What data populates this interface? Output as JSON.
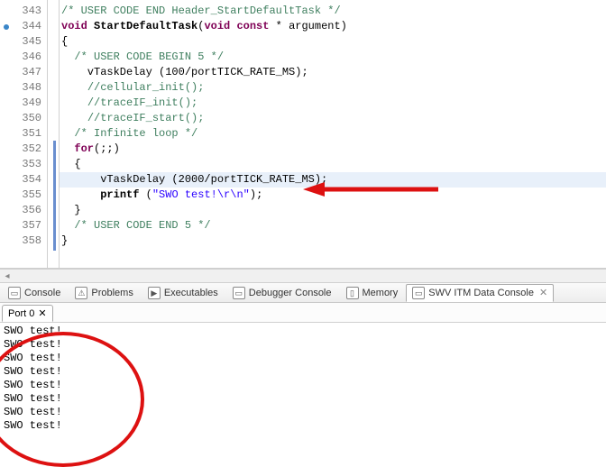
{
  "lines": [
    {
      "n": 343,
      "html": "<span class='cm'>/* USER CODE END Header_StartDefaultTask */</span>"
    },
    {
      "n": 344,
      "marked": true,
      "html": "<span class='kw'>void</span> <span class='fn'>StartDefaultTask</span>(<span class='kw'>void</span> <span class='kw'>const</span> * argument)"
    },
    {
      "n": 345,
      "html": "{"
    },
    {
      "n": 346,
      "html": "  <span class='cm'>/* USER CODE BEGIN 5 */</span>"
    },
    {
      "n": 347,
      "html": "    vTaskDelay (100/portTICK_RATE_MS);"
    },
    {
      "n": 348,
      "html": "    <span class='cm'>//cellular_init();</span>"
    },
    {
      "n": 349,
      "html": "    <span class='cm'>//traceIF_init();</span>"
    },
    {
      "n": 350,
      "html": "    <span class='cm'>//traceIF_start();</span>"
    },
    {
      "n": 351,
      "html": "  <span class='cm'>/* Infinite loop */</span>"
    },
    {
      "n": 352,
      "html": "  <span class='kw'>for</span>(;;)"
    },
    {
      "n": 353,
      "html": "  {"
    },
    {
      "n": 354,
      "hl": true,
      "html": "      vTaskDelay (2000/portTICK_RATE_MS);"
    },
    {
      "n": 355,
      "html": "      <span class='fn'>printf</span> (<span class='str'>\"SWO test!\\r\\n\"</span>);"
    },
    {
      "n": 356,
      "html": "  }"
    },
    {
      "n": 357,
      "html": "  <span class='cm'>/* USER CODE END 5 */</span>"
    },
    {
      "n": 358,
      "html": "}"
    }
  ],
  "tabs": [
    {
      "label": "Console",
      "icon": "▭"
    },
    {
      "label": "Problems",
      "icon": "⚠"
    },
    {
      "label": "Executables",
      "icon": "▶"
    },
    {
      "label": "Debugger Console",
      "icon": "▭"
    },
    {
      "label": "Memory",
      "icon": "▯"
    },
    {
      "label": "SWV ITM Data Console",
      "icon": "▭",
      "active": true,
      "closable": true
    }
  ],
  "port_tab": {
    "label": "Port 0",
    "close": "✕"
  },
  "console_lines": [
    "SWO test!",
    "SWO test!",
    "SWO test!",
    "SWO test!",
    "SWO test!",
    "SWO test!",
    "SWO test!",
    "SWO test!"
  ]
}
